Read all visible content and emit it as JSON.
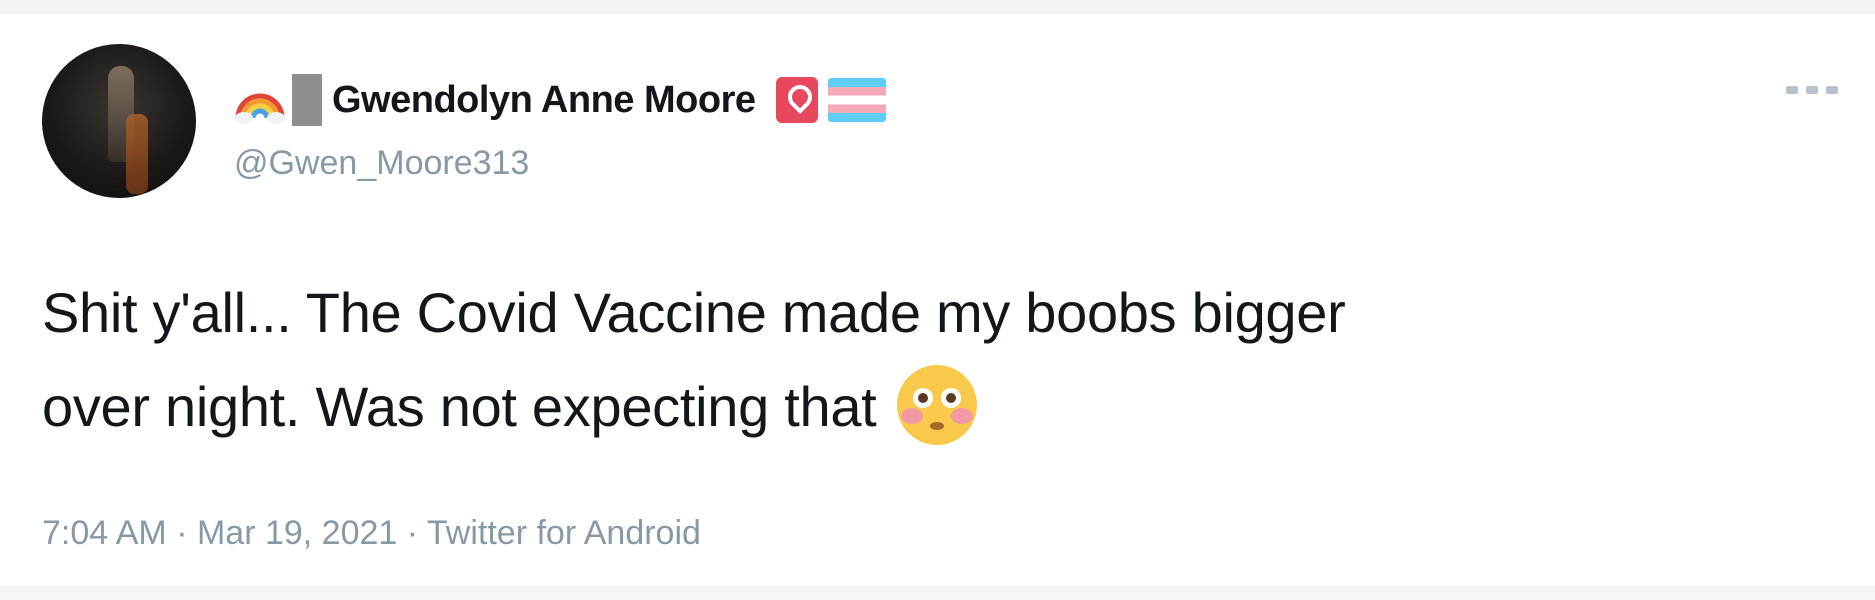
{
  "tweet": {
    "author": {
      "display_name": "Gwendolyn Anne Moore",
      "handle": "@Gwen_Moore313",
      "name_icons": [
        "rainbow-icon",
        "flag-block",
        "location-pin-icon",
        "trans-flag-icon"
      ]
    },
    "text_lines": [
      "Shit y'all... The Covid Vaccine made my boobs bigger",
      "over night. Was not expecting that"
    ],
    "text_end_emoji": "flushed-face-emoji",
    "timestamp": "7:04 AM · Mar 19, 2021 · Twitter for Android",
    "more_icon": "more-horizontal-icon"
  },
  "colors": {
    "text_primary": "#14171a",
    "text_secondary": "#8899a6",
    "pin_badge": "#e8485d",
    "border": "#f2f3f4"
  }
}
